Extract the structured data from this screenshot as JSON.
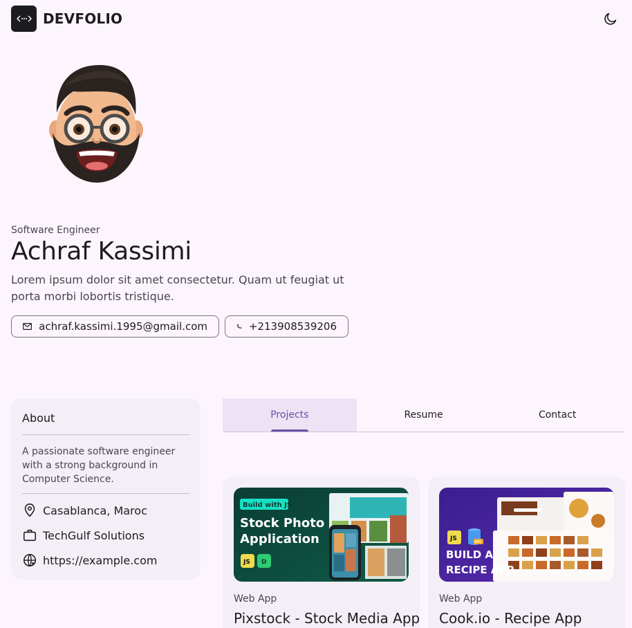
{
  "header": {
    "brand": "DEVFOLIO",
    "logo_icon": "code-dots-icon",
    "theme_icon": "moon-icon"
  },
  "hero": {
    "role": "Software Engineer",
    "name": "Achraf Kassimi",
    "bio": "Lorem ipsum dolor sit amet consectetur. Quam ut feugiat ut porta morbi lobortis tristique.",
    "email": "achraf.kassimi.1995@gmail.com",
    "phone": "+213908539206"
  },
  "about": {
    "title": "About",
    "text": "A passionate software engineer with a strong background in Computer Science.",
    "location": "Casablanca, Maroc",
    "company": "TechGulf Solutions",
    "website": "https://example.com"
  },
  "tabs": [
    {
      "label": "Projects",
      "active": true
    },
    {
      "label": "Resume",
      "active": false
    },
    {
      "label": "Contact",
      "active": false
    }
  ],
  "projects": [
    {
      "type": "Web App",
      "title": "Pixstock - Stock Media App",
      "thumb": {
        "badge": "Build with JS",
        "line1": "Stock Photo",
        "line2": "Application",
        "tech1": "JS",
        "tech2": "D"
      }
    },
    {
      "type": "Web App",
      "title": "Cook.io - Recipe App",
      "thumb": {
        "line1": "BUILD A",
        "line2": "RECIPE APP",
        "tech1": "JS",
        "tech2": "API"
      }
    }
  ],
  "colors": {
    "background": "#fdf5fd",
    "accent": "#6750a4",
    "card": "#f4eff6"
  }
}
